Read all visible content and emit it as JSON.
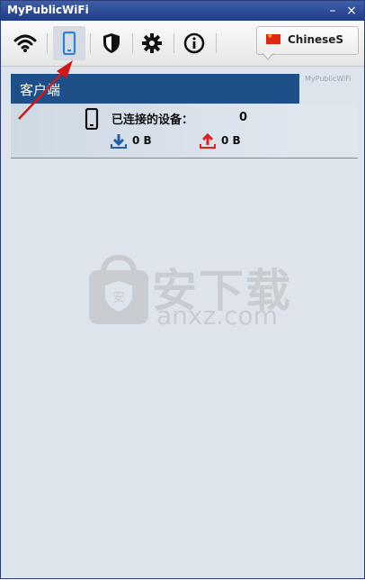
{
  "window": {
    "title": "MyPublicWiFi",
    "minimize": "–",
    "close": "×"
  },
  "toolbar": {
    "items": [
      "wifi-icon",
      "mobile-icon",
      "shield-icon",
      "gear-icon",
      "info-icon"
    ],
    "active": "mobile-icon",
    "language": "ChineseS"
  },
  "brand_watermark": "MyPublicWiFi",
  "tab": {
    "label": "客户端"
  },
  "clients": {
    "connected_label": "已连接的设备：",
    "connected_count": "0",
    "download": "0 B",
    "upload": "0 B"
  },
  "watermark": {
    "cn": "安下载",
    "en": "anxz.com",
    "badge": "安"
  },
  "colors": {
    "accent": "#1f4f89",
    "titlebar": "#1f3c86",
    "upload": "#e02020",
    "download": "#1f5fa8"
  }
}
